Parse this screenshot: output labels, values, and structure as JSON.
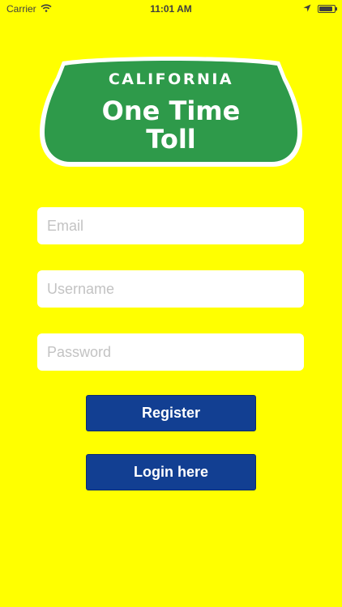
{
  "status_bar": {
    "carrier": "Carrier",
    "time": "11:01 AM",
    "battery_level": 0.9,
    "icons": [
      "wifi-icon",
      "location-arrow-icon",
      "battery-icon"
    ]
  },
  "logo": {
    "top_text": "CALIFORNIA",
    "line1": "One Time",
    "line2": "Toll",
    "green": "#2E9A4A",
    "bg": "#FFFF00"
  },
  "form": {
    "email_placeholder": "Email",
    "username_placeholder": "Username",
    "password_placeholder": "Password"
  },
  "buttons": {
    "register_label": "Register",
    "login_label": "Login here",
    "color": "#123F92"
  }
}
